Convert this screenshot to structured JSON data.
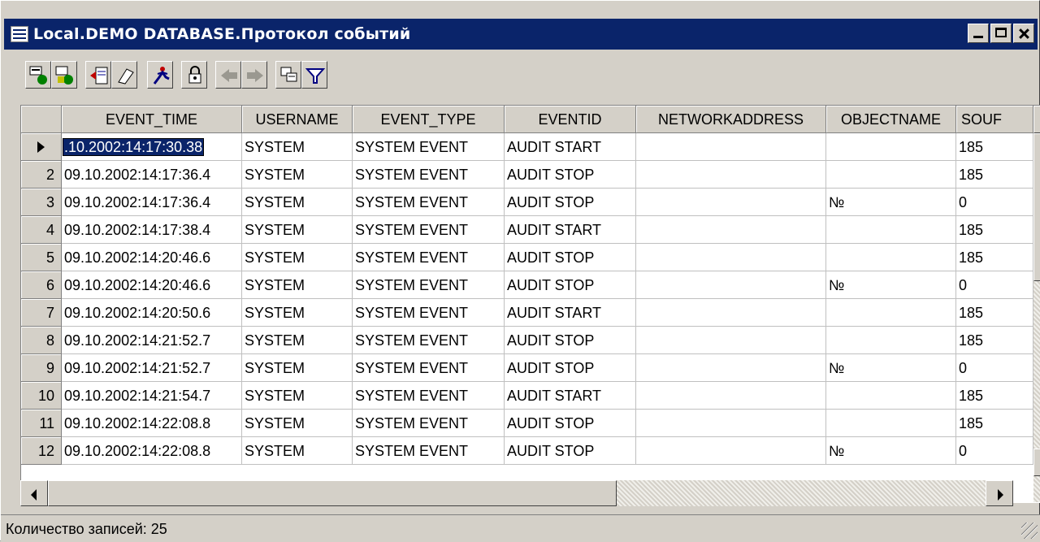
{
  "window": {
    "title": "Local.DEMO DATABASE.Протокол событий"
  },
  "toolbar": {
    "buttons": [
      {
        "icon": "import-filter-icon"
      },
      {
        "icon": "export-filter-icon"
      },
      {
        "icon": "insert-record-icon"
      },
      {
        "icon": "eraser-icon"
      },
      {
        "icon": "run-icon"
      },
      {
        "icon": "lock-icon"
      },
      {
        "icon": "prev-record-icon",
        "disabled": true
      },
      {
        "icon": "next-record-icon",
        "disabled": true
      },
      {
        "icon": "copy-icon"
      },
      {
        "icon": "filter-icon"
      }
    ]
  },
  "table": {
    "columns": [
      "EVENT_TIME",
      "USERNAME",
      "EVENT_TYPE",
      "EVENTID",
      "NETWORKADDRESS",
      "OBJECTNAME",
      "SOUF"
    ],
    "rows": [
      {
        "num": "",
        "current": true,
        "cells": [
          ".10.2002:14:17:30.38",
          "SYSTEM",
          "SYSTEM EVENT",
          "AUDIT START",
          "",
          "",
          "185"
        ]
      },
      {
        "num": "2",
        "cells": [
          "09.10.2002:14:17:36.4",
          "SYSTEM",
          "SYSTEM EVENT",
          "AUDIT STOP",
          "",
          "",
          "185"
        ]
      },
      {
        "num": "3",
        "cells": [
          "09.10.2002:14:17:36.4",
          "SYSTEM",
          "SYSTEM EVENT",
          "AUDIT STOP",
          "",
          "№",
          "0"
        ]
      },
      {
        "num": "4",
        "cells": [
          "09.10.2002:14:17:38.4",
          "SYSTEM",
          "SYSTEM EVENT",
          "AUDIT START",
          "",
          "",
          "185"
        ]
      },
      {
        "num": "5",
        "cells": [
          "09.10.2002:14:20:46.6",
          "SYSTEM",
          "SYSTEM EVENT",
          "AUDIT STOP",
          "",
          "",
          "185"
        ]
      },
      {
        "num": "6",
        "cells": [
          "09.10.2002:14:20:46.6",
          "SYSTEM",
          "SYSTEM EVENT",
          "AUDIT STOP",
          "",
          "№",
          "0"
        ]
      },
      {
        "num": "7",
        "cells": [
          "09.10.2002:14:20:50.6",
          "SYSTEM",
          "SYSTEM EVENT",
          "AUDIT START",
          "",
          "",
          "185"
        ]
      },
      {
        "num": "8",
        "cells": [
          "09.10.2002:14:21:52.7",
          "SYSTEM",
          "SYSTEM EVENT",
          "AUDIT STOP",
          "",
          "",
          "185"
        ]
      },
      {
        "num": "9",
        "cells": [
          "09.10.2002:14:21:52.7",
          "SYSTEM",
          "SYSTEM EVENT",
          "AUDIT STOP",
          "",
          "№",
          "0"
        ]
      },
      {
        "num": "10",
        "cells": [
          "09.10.2002:14:21:54.7",
          "SYSTEM",
          "SYSTEM EVENT",
          "AUDIT START",
          "",
          "",
          "185"
        ]
      },
      {
        "num": "11",
        "cells": [
          "09.10.2002:14:22:08.8",
          "SYSTEM",
          "SYSTEM EVENT",
          "AUDIT STOP",
          "",
          "",
          "185"
        ]
      },
      {
        "num": "12",
        "cells": [
          "09.10.2002:14:22:08.8",
          "SYSTEM",
          "SYSTEM EVENT",
          "AUDIT STOP",
          "",
          "№",
          "0"
        ]
      }
    ]
  },
  "status": {
    "text": "Количество записей: 25"
  }
}
